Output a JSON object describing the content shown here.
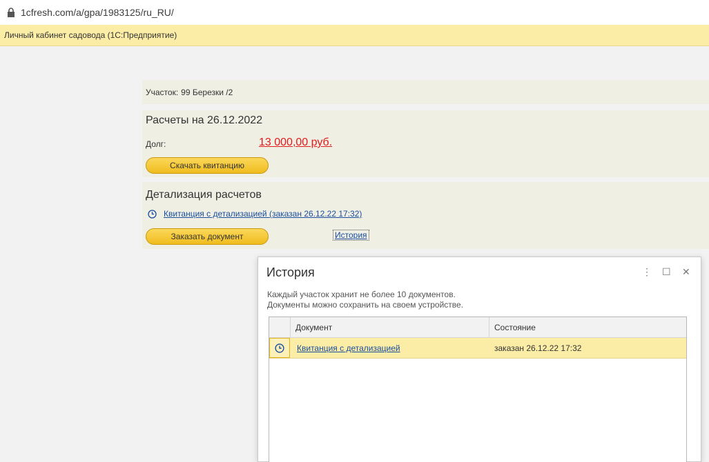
{
  "browser": {
    "url": "1cfresh.com/a/gpa/1983125/ru_RU/"
  },
  "window": {
    "title": "Личный кабинет садовода  (1С:Предприятие)"
  },
  "plot": {
    "label": "Участок:",
    "value": "99 Березки /2"
  },
  "calc": {
    "title": "Расчеты на 26.12.2022",
    "debt_label": "Долг:",
    "debt_value": "13 000,00 руб.",
    "download_button": "Скачать квитанцию"
  },
  "detail": {
    "title": "Детализация расчетов",
    "doc_link": "Квитанция с детализацией (заказан 26.12.22 17:32)",
    "order_button": "Заказать документ",
    "history_link": "История"
  },
  "dialog": {
    "title": "История",
    "note_line1": "Каждый участок хранит не более 10 документов.",
    "note_line2": "Документы можно сохранить на своем устройстве.",
    "columns": [
      "Документ",
      "Состояние"
    ],
    "rows": [
      {
        "icon": "clock-icon",
        "document": "Квитанция с детализацией",
        "status": "заказан 26.12.22 17:32"
      }
    ],
    "menu_icon": "⋮",
    "maximize_icon": "☐",
    "close_icon": "✕"
  },
  "colors": {
    "accent_yellow": "#f0bc1e",
    "debt_red": "#e01b1b",
    "link_blue": "#1a4d9e",
    "header_bar": "#fbeca6"
  }
}
